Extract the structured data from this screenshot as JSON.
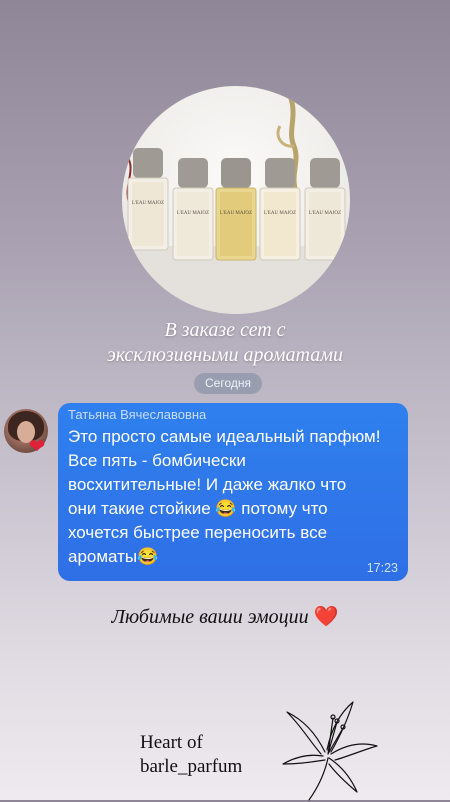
{
  "story": {
    "caption_line1": "В заказе сет с",
    "caption_line2": "эксклюзивными ароматами",
    "date_badge": "Сегодня"
  },
  "message": {
    "sender": "Татьяна Вячеславовна",
    "line1": "Это просто самые идеальный парфюм!",
    "line2": "Все пять  - бомбически",
    "line3": "восхитительные! И даже жалко что",
    "line4": "они такие стойкие 😂 потому что",
    "line5": "хочется быстрее переносить все",
    "line6": "ароматы😂",
    "time": "17:23",
    "avatar_badge": "❤"
  },
  "footer": {
    "emotions_text": "Любимые ваши эмоции",
    "emotions_heart": "❤️",
    "brand_line1": "Heart of",
    "brand_line2": "barle_parfum"
  },
  "product_labels": [
    "L'EAU MAJOZ",
    "L'EAU MAJOZ",
    "L'EAU MAJOZ",
    "L'EAU MAJOZ",
    "L'EAU MAJOZ"
  ],
  "colors": {
    "bubble": "#2f7aee",
    "heart": "#e0213a",
    "caption": "#ffffff"
  },
  "icons": {
    "avatar_badge": "heart-icon",
    "decoration": "lily-flower-icon"
  }
}
